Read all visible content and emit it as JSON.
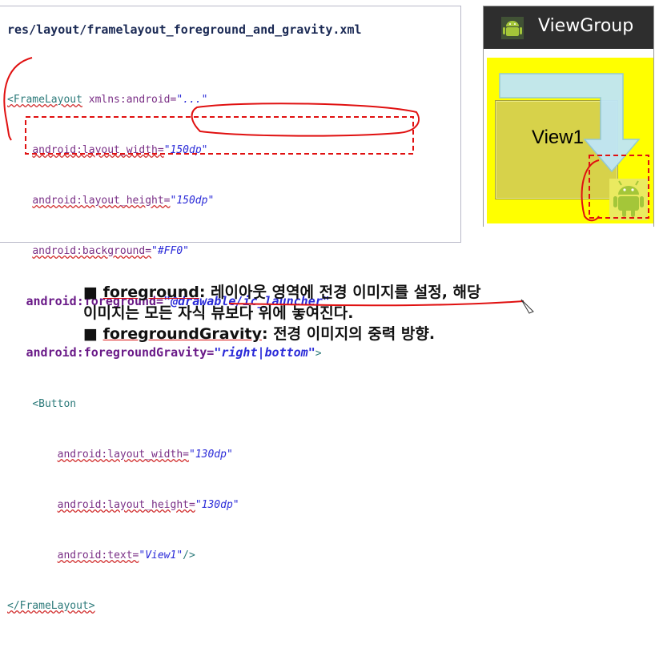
{
  "code_panel": {
    "title": "res/layout/framelayout_foreground_and_gravity.xml",
    "lines": {
      "l1_tag": "<FrameLayout",
      "l1_attr": " xmlns:android=",
      "l1_val": "\"...\"",
      "l2_attr": "android:layout_width=",
      "l2_val": "\"150dp\"",
      "l3_attr": "android:layout_height=",
      "l3_val": "\"150dp\"",
      "l4_attr": "android:background=",
      "l4_val": "\"#FF0\"",
      "l5_attr": "android:foreground=",
      "l5_val": "\"@drawable/ic_launcher\"",
      "l6_attr": "android:foregroundGravity=",
      "l6_val": "\"right|bottom\"",
      "l6_end": ">",
      "l7_tag": "<Button",
      "l8_attr": "android:layout_width=",
      "l8_val": "\"130dp\"",
      "l9_attr": "android:layout_height=",
      "l9_val": "\"130dp\"",
      "l10_attr": "android:text=",
      "l10_val": "\"View1\"",
      "l10_end": "/>",
      "l11_tag": "</FrameLayout>"
    }
  },
  "device_preview": {
    "app_title": "ViewGroup",
    "button_label": "View1",
    "icons": [
      "android-logo-icon",
      "arrow-down-icon"
    ],
    "colors": {
      "frame_background": "#ffff00",
      "button": "#d7d24a",
      "arrow": "#bfe6f7"
    }
  },
  "notes": {
    "bullet": "■",
    "foreground_term": "foreground",
    "foreground_desc_1": ": 레이아웃 영역에 전경 이미지를 설정, 해당",
    "foreground_desc_2": "이미지는 모든 자식 뷰보다 위에 놓여진다.",
    "gravity_term": "foregroundGravity",
    "gravity_desc": ":  전경 이미지의 중력 방향."
  }
}
